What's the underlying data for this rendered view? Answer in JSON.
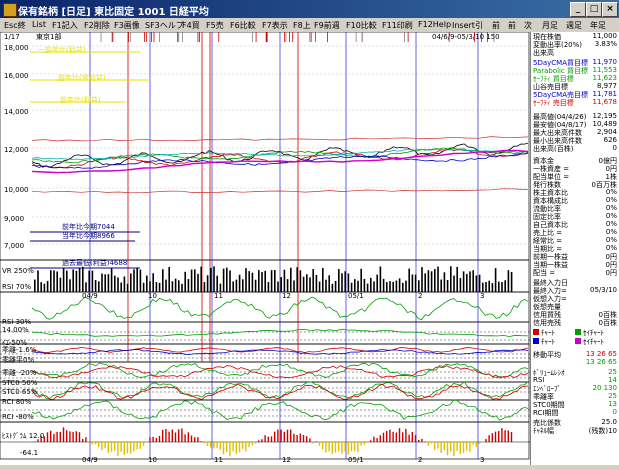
{
  "window": {
    "title": "保有銘柄 [日足] 東比固定 1001 日経平均",
    "minimize": "_",
    "maximize": "□",
    "close": "×"
  },
  "menu": [
    "Esc終",
    "List",
    "F1記入",
    "F2削除",
    "F3画像",
    "SF3ヘルプ",
    "F4買",
    "F5売",
    "F6比較",
    "F7表示",
    "F8上",
    "F9前週",
    "F10比較",
    "F11印刷",
    "F12Help",
    "Insert引",
    "前",
    "前",
    "次",
    "月足",
    "週足",
    "年足"
  ],
  "chart": {
    "counter": "1/17",
    "market": "東京1部",
    "range": "04/6/9-05/3/10 150",
    "price_ticks": [
      "18,000",
      "16,000",
      "14,000",
      "12,000",
      "10,000",
      "9,000",
      "7,000"
    ],
    "yellow_notes": [
      "一前年比(利益)",
      "前年比(営利益)",
      "前年比(利益)"
    ],
    "blue_notes": [
      "前年比今期7044",
      "当年比今期8966",
      "過去最低(利益)4688"
    ],
    "date_labels": [
      "04/9",
      "10",
      "11",
      "12",
      "05/1",
      "2",
      "3"
    ],
    "panel_labels": [
      "VR 250%",
      "RSI 70%",
      "RSI 30%",
      "14.00%",
      "ｲｴ-50%",
      "乖離-1.6%",
      "乖離平0%",
      "乖離 -20%",
      "STC0 50%",
      "STC0 65%",
      "RCI 80%",
      "RCI -80%",
      "ﾋｽﾄｸﾞﾗﾑ 12.0",
      "-64.1"
    ]
  },
  "info_panel": {
    "top": [
      {
        "label": "現在株価",
        "value": "11,000"
      },
      {
        "label": "変動出率(20%)",
        "value": "3.83%"
      },
      {
        "label": "出来高",
        "value": ""
      }
    ],
    "ma": [
      {
        "label": "5DayCMA買目標",
        "value": "11,970",
        "color": "#0000cc"
      },
      {
        "label": "Parabolic 買目標",
        "value": "11,553",
        "color": "#00a000"
      },
      {
        "label": "ｾｰﾌﾃｨ 買目標",
        "value": "11,623",
        "color": "#00a000"
      },
      {
        "label": "山谷売目標",
        "value": "8,977",
        "color": "#000000"
      },
      {
        "label": "5DayCMA売目標",
        "value": "11,781",
        "color": "#0000cc"
      },
      {
        "label": "ｾｰﾌﾃｨ 売目標",
        "value": "11,678",
        "color": "#cc0000"
      }
    ],
    "stats": [
      {
        "label": "最高値(04/4/26)",
        "value": "12,195"
      },
      {
        "label": "最安値(04/8/17)",
        "value": "10,489"
      },
      {
        "label": "最大出来高件数",
        "value": "2,904"
      },
      {
        "label": "最小出来高件数",
        "value": "626"
      },
      {
        "label": "出来高(百株)",
        "value": "0"
      }
    ],
    "ratios": [
      {
        "label": "資本金",
        "value": "0億円"
      },
      {
        "label": "一株資産 =",
        "value": "0円"
      },
      {
        "label": "配当単位 =",
        "value": "1株"
      },
      {
        "label": "発行株数",
        "value": "0百万株"
      },
      {
        "label": "株主資本比",
        "value": "0%"
      },
      {
        "label": "資本構成比",
        "value": "0%"
      },
      {
        "label": "流動比率",
        "value": "0%"
      },
      {
        "label": "固定比率",
        "value": "0%"
      },
      {
        "label": "自己資本比",
        "value": "0%"
      },
      {
        "label": "売上比 =",
        "value": "0%"
      },
      {
        "label": "経常比 =",
        "value": "0%"
      },
      {
        "label": "当期比 =",
        "value": "0%"
      },
      {
        "label": "前期一株益",
        "value": "0円"
      },
      {
        "label": "当期一株益",
        "value": "0円"
      },
      {
        "label": "配当 =",
        "value": "0円"
      }
    ],
    "trade": [
      {
        "label": "最終入力日",
        "value": ""
      },
      {
        "label": "最終入力=",
        "value": "05/3/10"
      },
      {
        "label": "仮想入力=",
        "value": ""
      },
      {
        "label": "仮想売量",
        "value": ""
      },
      {
        "label": "信用買残",
        "value": "0百株"
      },
      {
        "label": "信用売残",
        "value": "0百株"
      }
    ],
    "legend": [
      {
        "label": "ﾁｬｰﾄ",
        "color": "#cc0000"
      },
      {
        "label": "ｾｲﾁｬｰﾄ",
        "color": "#00a000"
      },
      {
        "label": "ﾁｬｰﾄ",
        "color": "#0000cc"
      },
      {
        "label": "ｾｲﾁｬｰﾄ",
        "color": "#cc00cc"
      }
    ],
    "indicators": [
      {
        "label": "移動平均",
        "value": "13 26 65"
      },
      {
        "label": "",
        "value": "13 26 65"
      },
      {
        "label": "ﾎﾞﾘｭｰﾑﾚｼｵ",
        "value": "25"
      },
      {
        "label": "RSI",
        "value": "14"
      },
      {
        "label": "ｴﾝﾍﾞﾛｰﾌﾟ",
        "value": "20 130"
      },
      {
        "label": "乖離率",
        "value": "25"
      },
      {
        "label": "STC0期間",
        "value": "13"
      },
      {
        "label": "RCI期間",
        "value": "0"
      },
      {
        "label": "売比係数",
        "value": "25.0"
      },
      {
        "label": "ﾁｬﾈﾙ幅",
        "value": "(残数)10"
      }
    ]
  }
}
